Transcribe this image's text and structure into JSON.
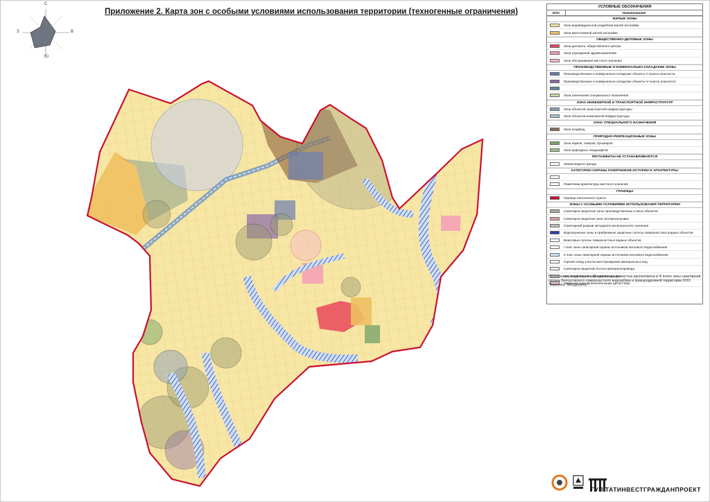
{
  "title": "Приложение 2. Карта зон с особыми условиями использования территории (техногенные ограничения)",
  "compass": {
    "north": "С",
    "south": "Ю",
    "west": "З",
    "east": "В"
  },
  "legend": {
    "header": "УСЛОВНЫЕ ОБОЗНАЧЕНИЯ",
    "col_num": "Nп/п",
    "col_name": "Наименование",
    "sections": [
      {
        "title": "ЖИЛЫЕ ЗОНЫ",
        "items": [
          {
            "label": "Зона индивидуальной усадебной жилой застройки",
            "color": "#f7e6a4"
          },
          {
            "label": "Зона малоэтажной жилой застройки",
            "color": "#f0c060"
          }
        ]
      },
      {
        "title": "ОБЩЕСТВЕННО-ДЕЛОВЫЕ ЗОНЫ",
        "items": [
          {
            "label": "Зона делового, общественного центра",
            "color": "#e8485a"
          },
          {
            "label": "Зона учреждений здравоохранения",
            "color": "#f29ab8"
          },
          {
            "label": "Зона обслуживания местного значения",
            "color": "#f7b9c8"
          }
        ]
      },
      {
        "title": "ПРОИЗВОДСТВЕННЫЕ И КОММУНАЛЬНО-СКЛАДСКИЕ ЗОНЫ",
        "items": [
          {
            "label": "Производственные и коммунально-складские объекты V класса опасности",
            "color": "#6c7fb0"
          },
          {
            "label": "Производственные и коммунально-складские объекты IV класса опасности",
            "color": "#8a6aa8"
          },
          {
            "label": "",
            "color": "#5b8aa0"
          },
          {
            "label": "Зона озеленения специального назначения",
            "color": "#c9d99a"
          }
        ]
      },
      {
        "title": "ЗОНА ИНЖЕНЕРНОЙ И ТРАНСПОРТНОЙ ИНФРАСТРУКТУР",
        "items": [
          {
            "label": "Зона объектов транспортной инфраструктуры",
            "color": "#8ca0b8"
          },
          {
            "label": "Зона объектов инженерной инфраструктуры",
            "color": "#a8c6d0"
          }
        ]
      },
      {
        "title": "ЗОНА СПЕЦИАЛЬНОГО НАЗНАЧЕНИЯ",
        "items": [
          {
            "label": "Зона кладбищ",
            "color": "#8a7060"
          }
        ]
      },
      {
        "title": "ПРИРОДНО-РЕКРЕАЦИОННЫЕ ЗОНЫ",
        "items": [
          {
            "label": "Зона парков, скверов, бульваров",
            "color": "#7aa56a"
          },
          {
            "label": "Зона природных ландшафтов",
            "color": "#9ec48a"
          }
        ]
      },
      {
        "title": "РЕГЛАМЕНТЫ НЕ УСТАНАВЛИВАЮТСЯ",
        "items": [
          {
            "label": "Земли водного фонда",
            "color": "#ffffff"
          }
        ]
      },
      {
        "title": "КАТЕГОРИИ ОХРАНЫ ПАМЯТНИКОВ ИСТОРИИ И АРХИТЕКТУРЫ",
        "items": [
          {
            "label": "",
            "color": "#ffffff"
          },
          {
            "label": "Памятники архитектуры местного значения",
            "color": "#ffffff"
          }
        ]
      },
      {
        "title": "ГРАНИЦЫ",
        "items": [
          {
            "label": "Граница населенного пункта",
            "color": "#c8102e"
          }
        ]
      },
      {
        "title": "ЗОНЫ С ОСОБЫМИ УСЛОВИЯМИ ИСПОЛЬЗОВАНИЯ ТЕРРИТОРИИ",
        "items": [
          {
            "label": "Санитарно-защитные зоны производственных и иных объектов",
            "color": "#b0b0a0"
          },
          {
            "label": "Санитарно-защитная зона скотомогильника",
            "color": "#d8a8a0"
          },
          {
            "label": "Санитарный разрыв автодороги регионального значения",
            "color": "#c0c0c0"
          },
          {
            "label": "Водоохранные зоны и прибрежные защитные полосы поверхностных водных объектов",
            "color": "#2a3fb0"
          },
          {
            "label": "Береговые полосы поверхностных водных объектов",
            "color": "#ffffff"
          },
          {
            "label": "I пояс зоны санитарной охраны источников питьевого водоснабжения",
            "color": "#ffffff"
          },
          {
            "label": "II пояс зоны санитарной охраны источников питьевого водоснабжения",
            "color": "#cfe4f4"
          },
          {
            "label": "Горный отвод участка месторождения минеральных вод",
            "color": "#ffffff"
          },
          {
            "label": "Санитарно-защитная полоса минералопровода",
            "color": "#e8f0f8"
          },
          {
            "label": "Охранная зона линий электропередач",
            "color": "#ffffff"
          },
          {
            "label": "Охранная зона флешеобольших диспетчера",
            "color": "#f4c8e0"
          }
        ]
      }
    ]
  },
  "note": "Примечание: территория г. Менделинска полностью расположена в III поясе зоны санитарной охраны Белоусовского поверхностного водозабора и приаэродромной территории ООО \"Агросоюз \"Менделинск\"",
  "footer": {
    "org": "ГУП ТАТИНВЕСТГРАЖДАНПРОЕКТ",
    "logo1": "SGS",
    "logo2": "UKAS",
    "logo3": "ТИГП"
  }
}
